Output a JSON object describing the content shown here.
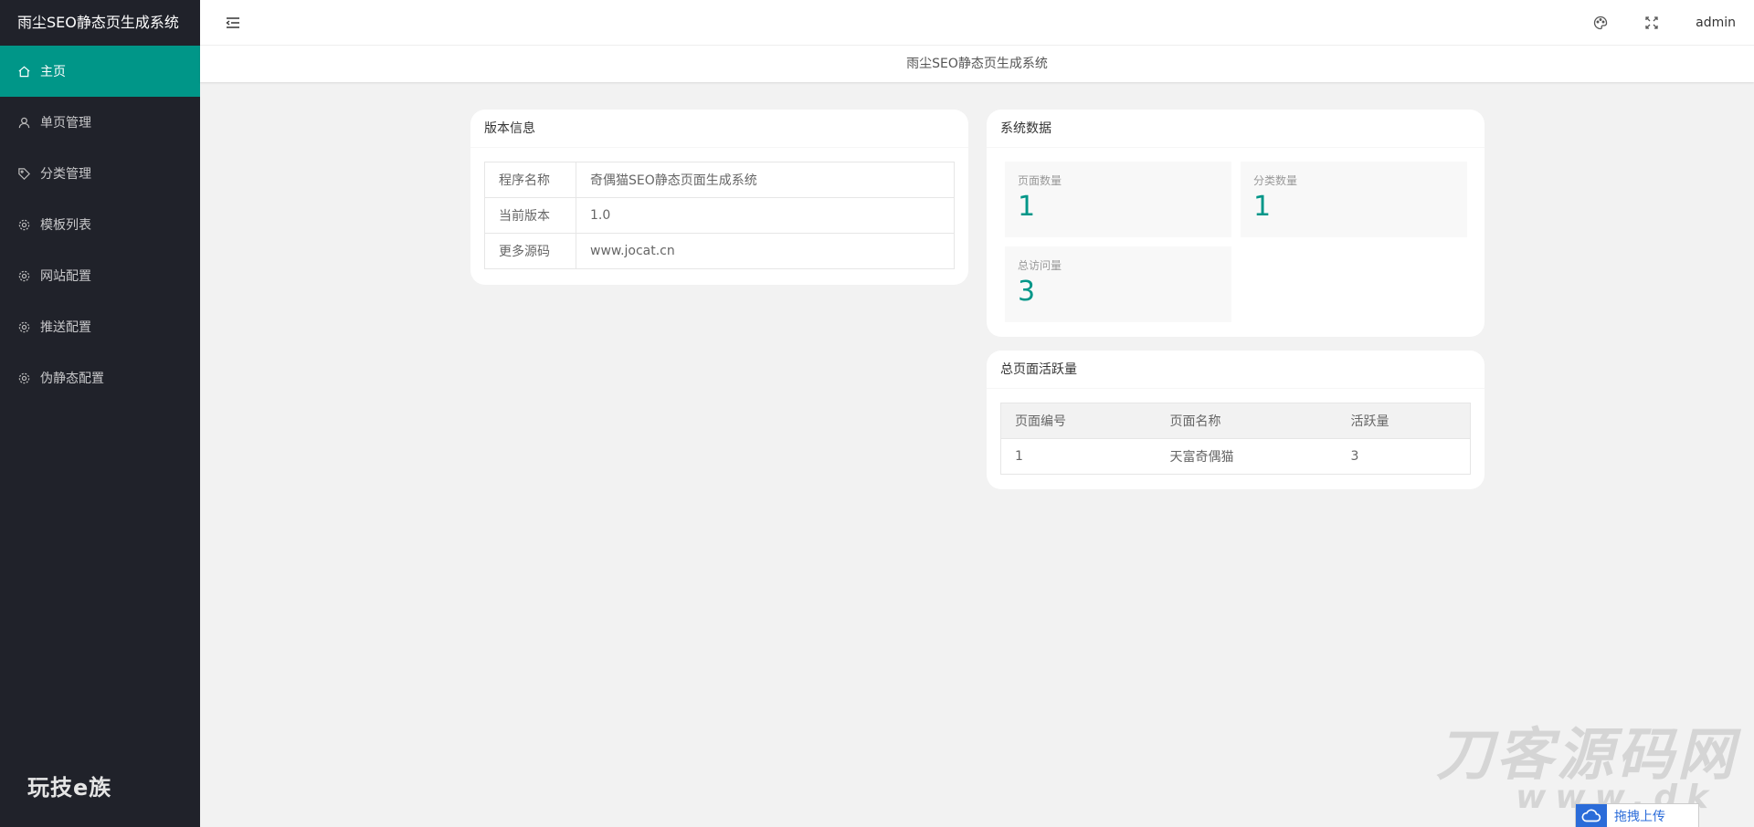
{
  "app": {
    "title": "雨尘SEO静态页生成系统"
  },
  "sidebar": {
    "items": [
      {
        "label": "主页",
        "icon": "home-icon",
        "active": true
      },
      {
        "label": "单页管理",
        "icon": "user-icon"
      },
      {
        "label": "分类管理",
        "icon": "tag-icon"
      },
      {
        "label": "模板列表",
        "icon": "gear-icon"
      },
      {
        "label": "网站配置",
        "icon": "gear-icon"
      },
      {
        "label": "推送配置",
        "icon": "gear-icon"
      },
      {
        "label": "伪静态配置",
        "icon": "gear-icon"
      }
    ],
    "footer_logo": "玩技e族"
  },
  "header": {
    "user": "admin"
  },
  "tabbar": {
    "title": "雨尘SEO静态页生成系统"
  },
  "version_card": {
    "title": "版本信息",
    "rows": [
      {
        "key": "程序名称",
        "value": "奇偶猫SEO静态页面生成系统"
      },
      {
        "key": "当前版本",
        "value": "1.0"
      },
      {
        "key": "更多源码",
        "value": "www.jocat.cn"
      }
    ]
  },
  "stats_card": {
    "title": "系统数据",
    "items": [
      {
        "label": "页面数量",
        "value": "1"
      },
      {
        "label": "分类数量",
        "value": "1"
      },
      {
        "label": "总访问量",
        "value": "3"
      }
    ]
  },
  "activity_card": {
    "title": "总页面活跃量",
    "columns": [
      "页面编号",
      "页面名称",
      "活跃量"
    ],
    "rows": [
      [
        "1",
        "天富奇偶猫",
        "3"
      ]
    ]
  },
  "overlay": {
    "watermark": "刀客源码网",
    "watermark_url": "www.dk  ",
    "upload_label": "拖拽上传"
  },
  "colors": {
    "accent": "#009688",
    "sidebar_bg": "#20222a"
  }
}
